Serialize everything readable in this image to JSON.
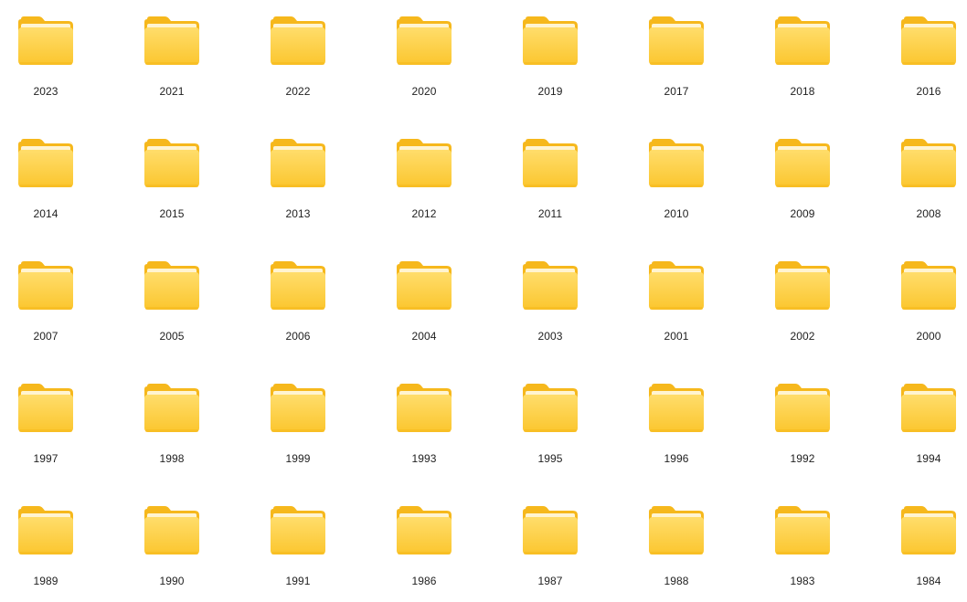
{
  "folders": [
    [
      "2023",
      "2021",
      "2022",
      "2020",
      "2019",
      "2017",
      "2018",
      "2016"
    ],
    [
      "2014",
      "2015",
      "2013",
      "2012",
      "2011",
      "2010",
      "2009",
      "2008"
    ],
    [
      "2007",
      "2005",
      "2006",
      "2004",
      "2003",
      "2001",
      "2002",
      "2000"
    ],
    [
      "1997",
      "1998",
      "1999",
      "1993",
      "1995",
      "1996",
      "1992",
      "1994"
    ],
    [
      "1989",
      "1990",
      "1991",
      "1986",
      "1987",
      "1988",
      "1983",
      "1984"
    ]
  ],
  "icon": "folder-icon",
  "colors": {
    "folder_back": "#f6b81c",
    "folder_front_top": "#ffdd6b",
    "folder_front_bottom": "#fbc62e",
    "folder_sheet": "#fff4d1",
    "label_text": "#1f1f1f",
    "background": "#ffffff"
  }
}
